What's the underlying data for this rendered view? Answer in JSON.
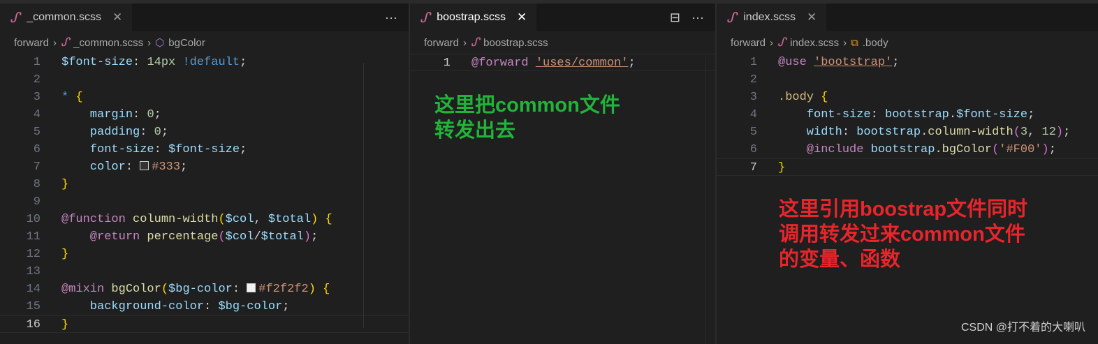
{
  "panes": [
    {
      "tab": "_common.scss",
      "crumb": [
        "forward",
        "_common.scss",
        "bgColor"
      ],
      "current_line": 16,
      "lines": [
        [
          [
            "$font-size",
            "prop"
          ],
          [
            ": ",
            "pl"
          ],
          [
            "14px",
            "num"
          ],
          [
            " ",
            "pl"
          ],
          [
            "!default",
            "imp"
          ],
          [
            ";",
            "pl"
          ]
        ],
        [],
        [
          [
            "*",
            "imp"
          ],
          [
            " ",
            "pl"
          ],
          [
            "{",
            "br"
          ]
        ],
        [
          [
            "    margin",
            "prop"
          ],
          [
            ": ",
            "pl"
          ],
          [
            "0",
            "num"
          ],
          [
            ";",
            "pl"
          ]
        ],
        [
          [
            "    padding",
            "prop"
          ],
          [
            ": ",
            "pl"
          ],
          [
            "0",
            "num"
          ],
          [
            ";",
            "pl"
          ]
        ],
        [
          [
            "    font-size",
            "prop"
          ],
          [
            ": ",
            "pl"
          ],
          [
            "$font-size",
            "prop"
          ],
          [
            ";",
            "pl"
          ]
        ],
        [
          [
            "    color",
            "prop"
          ],
          [
            ": ",
            "pl"
          ],
          [
            "#333333",
            "swatch"
          ],
          [
            "#333",
            "str"
          ],
          [
            ";",
            "pl"
          ]
        ],
        [
          [
            "}",
            "br"
          ]
        ],
        [],
        [
          [
            "@function",
            "kw"
          ],
          [
            " ",
            "pl"
          ],
          [
            "column-width",
            "fn"
          ],
          [
            "(",
            "br"
          ],
          [
            "$col",
            "prop"
          ],
          [
            ", ",
            "pl"
          ],
          [
            "$total",
            "prop"
          ],
          [
            ")",
            "br"
          ],
          [
            " ",
            "pl"
          ],
          [
            "{",
            "br"
          ]
        ],
        [
          [
            "    @return",
            "kw"
          ],
          [
            " ",
            "pl"
          ],
          [
            "percentage",
            "fn"
          ],
          [
            "(",
            "pa"
          ],
          [
            "$col",
            "prop"
          ],
          [
            "/",
            "pl"
          ],
          [
            "$total",
            "prop"
          ],
          [
            ")",
            "pa"
          ],
          [
            ";",
            "pl"
          ]
        ],
        [
          [
            "}",
            "br"
          ]
        ],
        [],
        [
          [
            "@mixin",
            "kw"
          ],
          [
            " ",
            "pl"
          ],
          [
            "bgColor",
            "fn"
          ],
          [
            "(",
            "br"
          ],
          [
            "$bg-color",
            "prop"
          ],
          [
            ": ",
            "pl"
          ],
          [
            "#f2f2f2",
            "swatch"
          ],
          [
            "#f2f2f2",
            "str"
          ],
          [
            ")",
            "br"
          ],
          [
            " ",
            "pl"
          ],
          [
            "{",
            "br"
          ]
        ],
        [
          [
            "    background-color",
            "prop"
          ],
          [
            ": ",
            "pl"
          ],
          [
            "$bg-color",
            "prop"
          ],
          [
            ";",
            "pl"
          ]
        ],
        [
          [
            "}",
            "br"
          ]
        ]
      ]
    },
    {
      "tab": "boostrap.scss",
      "crumb": [
        "forward",
        "boostrap.scss"
      ],
      "current_line": 1,
      "lines": [
        [
          [
            "@forward",
            "kw"
          ],
          [
            " ",
            "pl"
          ],
          [
            "'uses/common'",
            "str u"
          ],
          [
            ";",
            "pl"
          ]
        ]
      ]
    },
    {
      "tab": "index.scss",
      "crumb": [
        "forward",
        "index.scss",
        ".body"
      ],
      "current_line": 7,
      "lines": [
        [
          [
            "@use",
            "kw"
          ],
          [
            " ",
            "pl"
          ],
          [
            "'bootstrap'",
            "str u"
          ],
          [
            ";",
            "pl"
          ]
        ],
        [],
        [
          [
            ".body",
            "sel"
          ],
          [
            " ",
            "pl"
          ],
          [
            "{",
            "br"
          ]
        ],
        [
          [
            "    font-size",
            "prop"
          ],
          [
            ": ",
            "pl"
          ],
          [
            "bootstrap",
            "prop"
          ],
          [
            ".",
            "pl"
          ],
          [
            "$font-size",
            "prop"
          ],
          [
            ";",
            "pl"
          ]
        ],
        [
          [
            "    width",
            "prop"
          ],
          [
            ": ",
            "pl"
          ],
          [
            "bootstrap",
            "prop"
          ],
          [
            ".",
            "pl"
          ],
          [
            "column-width",
            "fn"
          ],
          [
            "(",
            "pa"
          ],
          [
            "3",
            "num"
          ],
          [
            ", ",
            "pl"
          ],
          [
            "12",
            "num"
          ],
          [
            ")",
            "pa"
          ],
          [
            ";",
            "pl"
          ]
        ],
        [
          [
            "    @include",
            "kw"
          ],
          [
            " ",
            "pl"
          ],
          [
            "bootstrap",
            "prop"
          ],
          [
            ".",
            "pl"
          ],
          [
            "bgColor",
            "fn"
          ],
          [
            "(",
            "pa"
          ],
          [
            "'#F00'",
            "str"
          ],
          [
            ")",
            "pa"
          ],
          [
            ";",
            "pl"
          ]
        ],
        [
          [
            "}",
            "br"
          ]
        ]
      ]
    }
  ],
  "notes": {
    "green": [
      "这里把common文件",
      "转发出去"
    ],
    "red": [
      "这里引用boostrap文件同时",
      "调用转发过来common文件",
      "的变量、函数"
    ],
    "green_color": "#22b43a",
    "red_color": "#e8252b"
  },
  "watermark": "CSDN @打不着的大喇叭"
}
